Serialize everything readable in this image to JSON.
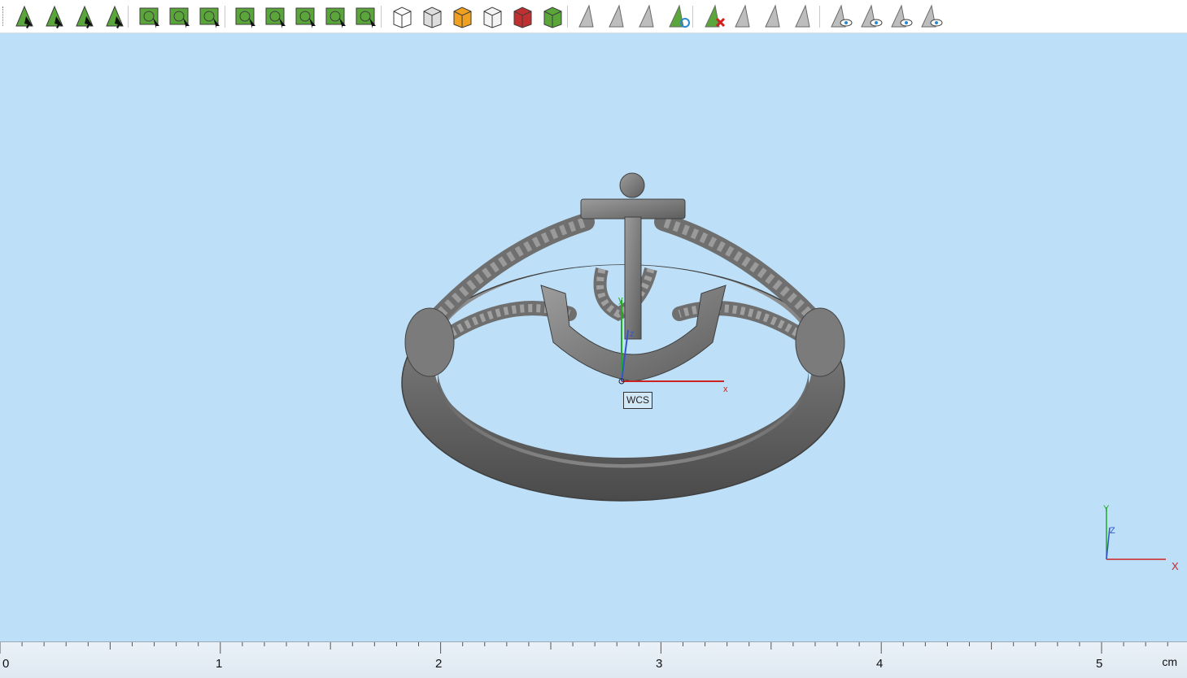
{
  "toolbar": {
    "buttons": [
      {
        "id": "select-points",
        "icon": "select-points-icon"
      },
      {
        "id": "select-surfaces",
        "icon": "select-surfaces-icon"
      },
      {
        "id": "select-curves",
        "icon": "select-curves-icon"
      },
      {
        "id": "select-sphere",
        "icon": "select-sphere-icon"
      },
      {
        "id": "rect-select",
        "icon": "rect-select-icon"
      },
      {
        "id": "lasso-select",
        "icon": "lasso-select-icon"
      },
      {
        "id": "path-select",
        "icon": "path-select-icon"
      },
      {
        "id": "mesh-select",
        "icon": "mesh-select-icon"
      },
      {
        "id": "brush-select",
        "icon": "brush-select-icon"
      },
      {
        "id": "star-select",
        "icon": "star-select-icon"
      },
      {
        "id": "radial-select",
        "icon": "radial-select-icon"
      },
      {
        "id": "radial-select-2",
        "icon": "radial-select-2-icon"
      },
      {
        "id": "cube-view",
        "icon": "cube-view-icon"
      },
      {
        "id": "cube-face-view",
        "icon": "cube-face-view-icon"
      },
      {
        "id": "cube-orange-view",
        "icon": "cube-orange-view-icon"
      },
      {
        "id": "cube-wire-view",
        "icon": "cube-wire-view-icon"
      },
      {
        "id": "cube-red-view",
        "icon": "cube-red-view-icon"
      },
      {
        "id": "cube-green-view",
        "icon": "cube-green-view-icon"
      },
      {
        "id": "tri-select",
        "icon": "triangle-select-icon"
      },
      {
        "id": "tri-select-2",
        "icon": "triangle-select-2-icon"
      },
      {
        "id": "tri-select-3",
        "icon": "triangle-select-3-icon"
      },
      {
        "id": "tri-refresh",
        "icon": "triangle-refresh-icon"
      },
      {
        "id": "tri-delete",
        "icon": "triangle-delete-icon"
      },
      {
        "id": "tri-hatch",
        "icon": "triangle-hatch-icon"
      },
      {
        "id": "tri-copy",
        "icon": "triangle-copy-icon"
      },
      {
        "id": "tri-edit",
        "icon": "triangle-edit-icon"
      },
      {
        "id": "tri-eye",
        "icon": "triangle-eye-icon"
      },
      {
        "id": "tri-eye-swap",
        "icon": "triangle-eye-swap-icon"
      },
      {
        "id": "tri-eye-blue",
        "icon": "triangle-eye-blue-icon"
      },
      {
        "id": "tri-eye-hide",
        "icon": "triangle-eye-hide-icon"
      }
    ]
  },
  "viewport": {
    "background": "#bde0f8",
    "wcs": {
      "label": "WCS",
      "x": "x",
      "y": "y",
      "z": "z"
    },
    "corner_axes": {
      "x": "X",
      "y": "Y",
      "z": "Z"
    }
  },
  "ruler": {
    "labels": [
      "0",
      "1",
      "2",
      "3",
      "4",
      "5"
    ],
    "unit": "cm"
  },
  "colors": {
    "axis_x": "#cc2222",
    "axis_y": "#22aa22",
    "axis_z": "#3355cc",
    "model": "#7a7a7a"
  }
}
